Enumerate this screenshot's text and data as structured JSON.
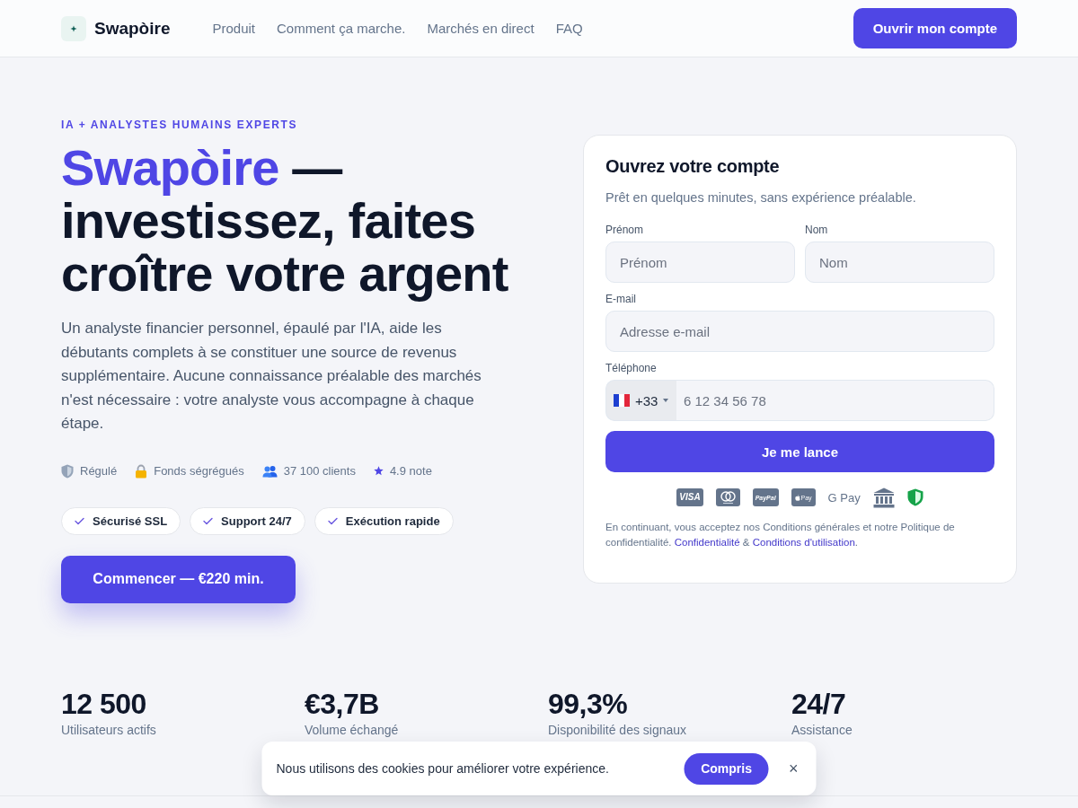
{
  "header": {
    "brand": "Swapòire",
    "nav": [
      {
        "label": "Produit"
      },
      {
        "label": "Comment ça marche."
      },
      {
        "label": "Marchés en direct"
      },
      {
        "label": "FAQ"
      }
    ],
    "cta": "Ouvrir mon compte"
  },
  "hero": {
    "eyebrow": "IA + ANALYSTES HUMAINS EXPERTS",
    "heading": {
      "accent": "Swapòire",
      "rest": "— investissez, faites croître votre argent"
    },
    "description": "Un analyste financier personnel, épaulé par l'IA, aide les débutants complets à se constituer une source de revenus supplémentaire. Aucune connaissance préalable des marchés n'est nécessaire : votre analyste vous accompagne à chaque étape.",
    "trust": [
      {
        "kind": "shield",
        "label": "Régulé"
      },
      {
        "kind": "lock",
        "label": "Fonds ségrégués"
      },
      {
        "kind": "people",
        "label": "37 100 clients"
      },
      {
        "kind": "star",
        "label": "4.9 note"
      }
    ],
    "badges": [
      "Sécurisé SSL",
      "Support 24/7",
      "Exécution rapide"
    ],
    "cta": "Commencer — €220 min."
  },
  "signup": {
    "title": "Ouvrez votre compte",
    "subtitle": "Prêt en quelques minutes, sans expérience préalable.",
    "fields": [
      {
        "kind": "half",
        "label": "Prénom",
        "placeholder": "Prénom"
      },
      {
        "kind": "half",
        "label": "Nom",
        "placeholder": "Nom"
      },
      {
        "kind": "full",
        "label": "E-mail",
        "placeholder": "Adresse e-mail"
      },
      {
        "kind": "phone",
        "label": "Téléphone",
        "country_code": "+33",
        "placeholder": "6 12 34 56 78"
      }
    ],
    "submit": "Je me lance",
    "payments": [
      {
        "kind": "visa",
        "label": "VISA"
      },
      {
        "kind": "mastercard"
      },
      {
        "kind": "paypal",
        "label": "PayPal"
      },
      {
        "kind": "applepay",
        "label": "Pay"
      },
      {
        "kind": "gpay",
        "label": "G Pay"
      },
      {
        "kind": "bank"
      },
      {
        "kind": "shield"
      }
    ],
    "legal": {
      "text": "En continuant, vous acceptez nos Conditions générales et notre Politique de confidentialité.",
      "links": [
        "Confidentialité",
        "Conditions d'utilisation"
      ],
      "separator": "&",
      "end": "."
    }
  },
  "stats": [
    {
      "value": "12 500",
      "label": "Utilisateurs actifs"
    },
    {
      "value": "€3,7B",
      "label": "Volume échangé"
    },
    {
      "value": "99,3%",
      "label": "Disponibilité des signaux"
    },
    {
      "value": "24/7",
      "label": "Assistance"
    }
  ],
  "cookie_banner": {
    "text": "Nous utilisons des cookies pour améliorer votre expérience.",
    "accept": "Compris",
    "close": "×"
  }
}
